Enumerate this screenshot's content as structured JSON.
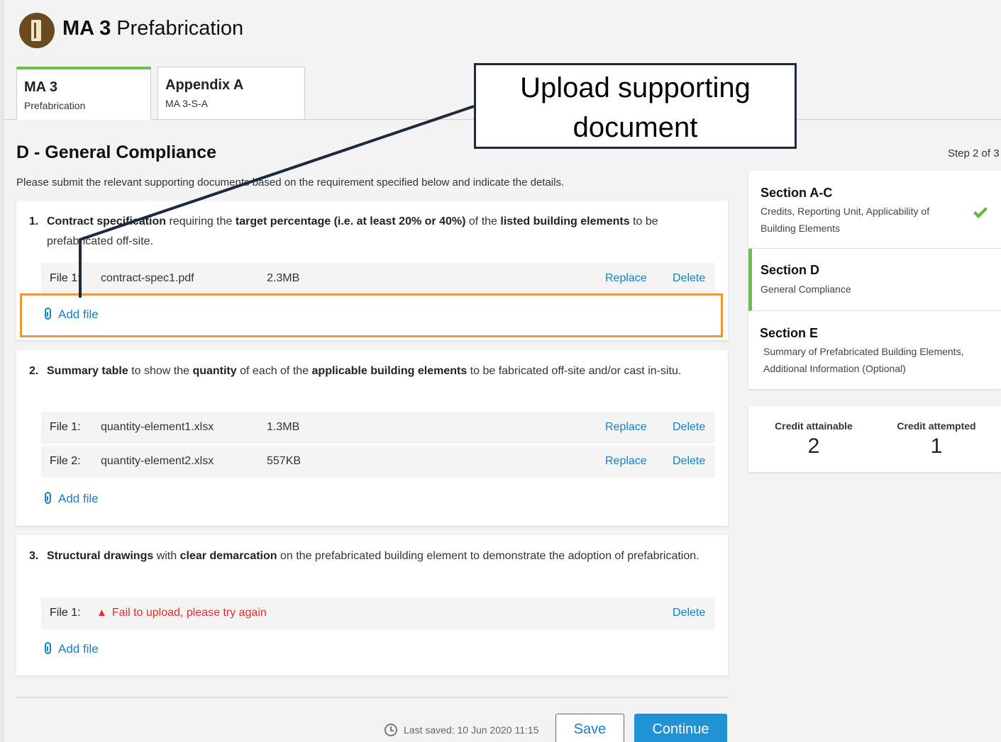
{
  "header": {
    "code": "MA 3",
    "title": "Prefabrication"
  },
  "tabs": [
    {
      "label": "MA 3",
      "sublabel": "Prefabrication",
      "active": true
    },
    {
      "label": "Appendix A",
      "sublabel": "MA 3-S-A",
      "active": false
    }
  ],
  "section": {
    "heading": "D - General Compliance",
    "step": "Step 2 of 3",
    "intro": "Please submit the relevant supporting documents based on the requirement specified below and indicate the details."
  },
  "requirements": [
    {
      "number": "1.",
      "parts": [
        {
          "t": "Contract specification",
          "b": true
        },
        {
          "t": " requiring the ",
          "b": false
        },
        {
          "t": "target percentage (i.e. at least 20% or 40%)",
          "b": true
        },
        {
          "t": " of the ",
          "b": false
        },
        {
          "t": "listed building elements",
          "b": true
        },
        {
          "t": " to be prefabricated off-site.",
          "b": false
        }
      ],
      "files": [
        {
          "label": "File 1:",
          "name": "contract-spec1.pdf",
          "size": "2.3MB",
          "replace": "Replace",
          "delete": "Delete"
        }
      ],
      "add_file": "Add file"
    },
    {
      "number": "2.",
      "parts": [
        {
          "t": "Summary table",
          "b": true
        },
        {
          "t": " to show the ",
          "b": false
        },
        {
          "t": "quantity",
          "b": true
        },
        {
          "t": " of each of the ",
          "b": false
        },
        {
          "t": "applicable building elements",
          "b": true
        },
        {
          "t": " to be fabricated off-site and/or cast in-situ.",
          "b": false
        }
      ],
      "files": [
        {
          "label": "File 1:",
          "name": "quantity-element1.xlsx",
          "size": "1.3MB",
          "replace": "Replace",
          "delete": "Delete"
        },
        {
          "label": "File 2:",
          "name": "quantity-element2.xlsx",
          "size": "557KB",
          "replace": "Replace",
          "delete": "Delete"
        }
      ],
      "add_file": "Add file"
    },
    {
      "number": "3.",
      "parts": [
        {
          "t": "Structural drawings",
          "b": true
        },
        {
          "t": " with ",
          "b": false
        },
        {
          "t": "clear demarcation",
          "b": true
        },
        {
          "t": " on the prefabricated building element to demonstrate the adoption of prefabrication.",
          "b": false
        }
      ],
      "files": [
        {
          "label": "File 1:",
          "error": "Fail to upload, please try again",
          "delete": "Delete"
        }
      ],
      "add_file": "Add file"
    }
  ],
  "sidebar": {
    "sections": [
      {
        "title": "Section A-C",
        "desc": "Credits, Reporting Unit, Applicability of Building Elements",
        "complete": true
      },
      {
        "title": "Section D",
        "desc": "General Compliance",
        "active": true
      },
      {
        "title": "Section E",
        "desc": "Summary of Prefabricated Building Elements, Additional Information (Optional)"
      }
    ],
    "credits": {
      "attainable_label": "Credit attainable",
      "attainable_value": "2",
      "attempted_label": "Credit attempted",
      "attempted_value": "1"
    }
  },
  "footer": {
    "last_saved": "Last saved: 10 Jun 2020 11:15",
    "save_label": "Save",
    "continue_label": "Continue"
  },
  "annotation": {
    "callout_text": "Upload supporting document"
  },
  "colors": {
    "accent_blue": "#1a7fc4",
    "active_green": "#6cc04a",
    "error_red": "#e0302a",
    "highlight_orange": "#f0953a"
  }
}
